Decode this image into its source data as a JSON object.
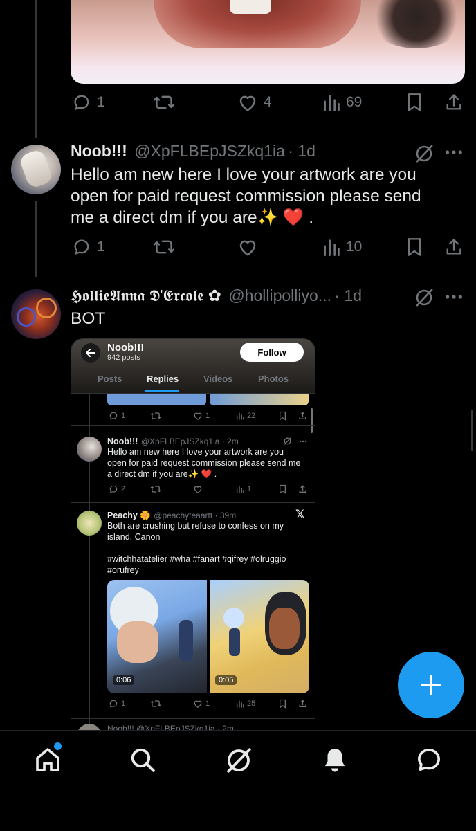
{
  "post1": {
    "actions": {
      "replies": "1",
      "likes": "4",
      "views": "69"
    }
  },
  "post2": {
    "name": "Noob!!!",
    "handle": "@XpFLBEpJSZkq1ia",
    "time": "· 1d",
    "text": "Hello am new here I love your artwork are you open for paid request commission please send me a direct dm if you are✨ ❤️ .",
    "actions": {
      "replies": "1",
      "views": "10"
    }
  },
  "post3": {
    "name": "𝕳𝖔𝖑𝖑𝖎𝖊𝕬𝖓𝖓𝖆 𝕯'𝕰𝖗𝖈𝖔𝖑𝖊 ✿",
    "handle": "@hollipolliyo...",
    "time": "· 1d",
    "text": "BOT"
  },
  "embed": {
    "profile_name": "Noob!!!",
    "profile_posts": "942 posts",
    "follow_label": "Follow",
    "tabs": [
      "Posts",
      "Replies",
      "Videos",
      "Photos"
    ],
    "row1_actions": {
      "replies": "1",
      "likes": "1",
      "views": "22"
    },
    "reply": {
      "name": "Noob!!!",
      "handle": "@XpFLBEpJSZkq1ia · 2m",
      "text": "Hello am new here I love your artwork are you open for paid request commission please send me a direct dm if you are✨ ❤️ .",
      "replies": "2",
      "views": "1"
    },
    "peachy": {
      "name": "Peachy 🌼",
      "handle": "@peachyteaartt · 39m",
      "text": "Both are crushing but refuse to confess on my island. Canon",
      "tags": "#witchhatatelier #wha #fanart #qifrey #olruggio #orufrey",
      "video1_time": "0:06",
      "video2_time": "0:05",
      "actions": {
        "replies": "1",
        "likes": "1",
        "views": "25"
      }
    },
    "next_row": "Noob!!! @XpFLBEpJSZkq1ia · 2m"
  },
  "nav": [
    "home-icon",
    "search-icon",
    "grok-icon",
    "notifications-icon",
    "messages-icon"
  ],
  "colors": {
    "accent": "#1d9bf0",
    "fab": "#1d9bf0",
    "muted": "#71767b",
    "heart": "#f91880"
  }
}
